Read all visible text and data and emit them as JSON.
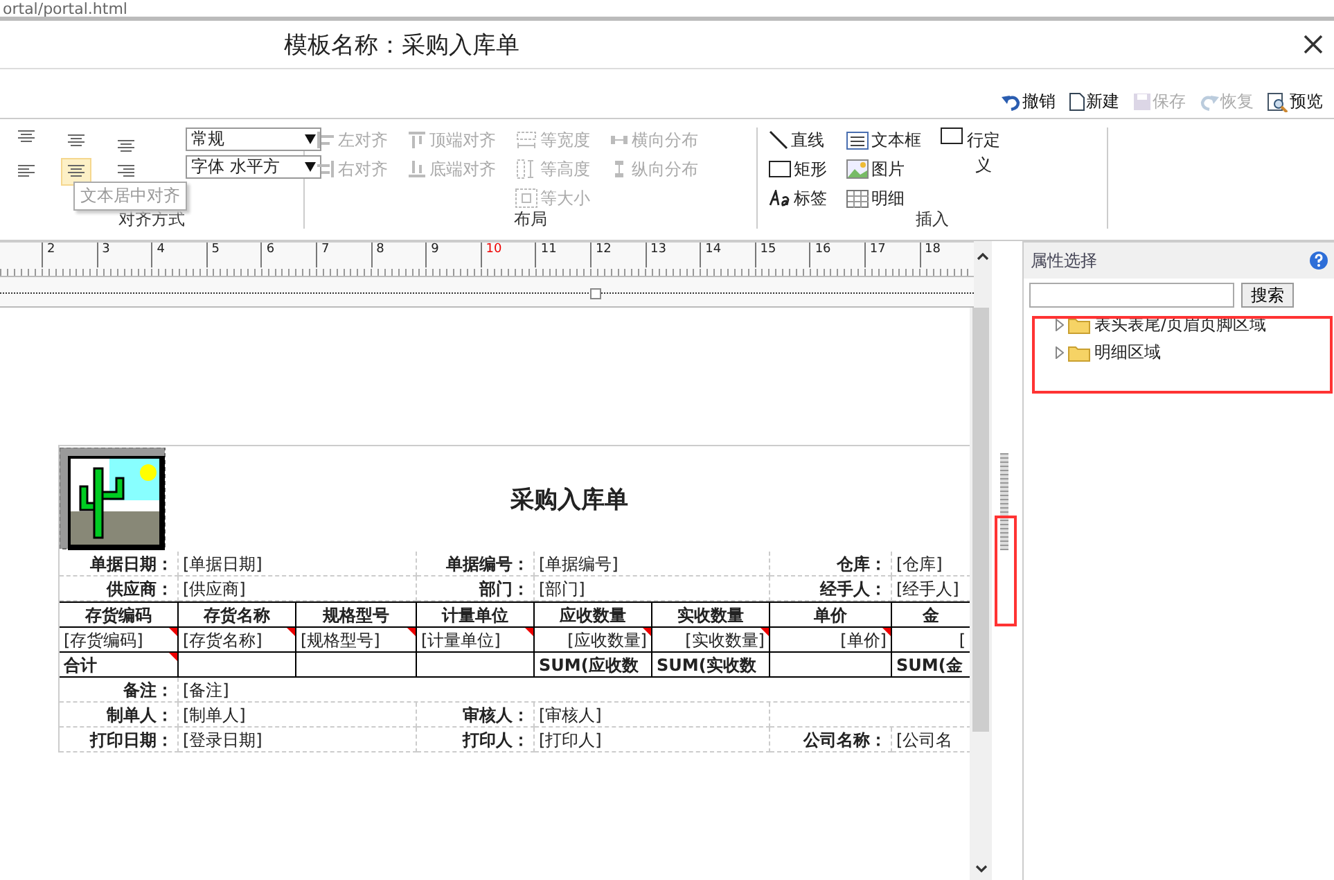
{
  "url": "ortal/portal.html",
  "window": {
    "title": "模板名称：采购入库单"
  },
  "toolbar": [
    {
      "label": "撤销",
      "kind": "undo",
      "disabled": false
    },
    {
      "label": "新建",
      "kind": "new",
      "disabled": false
    },
    {
      "label": "保存",
      "kind": "save",
      "disabled": true
    },
    {
      "label": "恢复",
      "kind": "redo",
      "disabled": true
    },
    {
      "label": "预览",
      "kind": "preview",
      "disabled": false
    }
  ],
  "alignment": {
    "title": "对齐方式",
    "tooltip": "文本居中对齐",
    "buttons": [
      {
        "kind": "top",
        "selected": false
      },
      {
        "kind": "middle",
        "selected": false
      },
      {
        "kind": "bottom",
        "selected": false
      },
      {
        "kind": "left",
        "selected": false
      },
      {
        "kind": "center",
        "selected": true
      },
      {
        "kind": "right",
        "selected": false
      }
    ],
    "selects": [
      "常规",
      "字体 水平方"
    ]
  },
  "layout": {
    "title": "布局",
    "columns": [
      [
        {
          "label": "左对齐",
          "kind": "align-left",
          "disabled": true
        },
        {
          "label": "右对齐",
          "kind": "align-right",
          "disabled": true
        }
      ],
      [
        {
          "label": "顶端对齐",
          "kind": "align-top",
          "disabled": true
        },
        {
          "label": "底端对齐",
          "kind": "align-bottom",
          "disabled": true
        }
      ],
      [
        {
          "label": "等宽度",
          "kind": "same-width",
          "disabled": true
        },
        {
          "label": "等高度",
          "kind": "same-height",
          "disabled": true
        },
        {
          "label": "等大小",
          "kind": "same-size",
          "disabled": true
        }
      ],
      [
        {
          "label": "横向分布",
          "kind": "dist-h",
          "disabled": true
        },
        {
          "label": "纵向分布",
          "kind": "dist-v",
          "disabled": true
        }
      ]
    ]
  },
  "insert": {
    "title": "插入",
    "columns": [
      [
        {
          "label": "直线",
          "kind": "line"
        },
        {
          "label": "矩形",
          "kind": "rect"
        },
        {
          "label": "标签",
          "kind": "label"
        }
      ],
      [
        {
          "label": "文本框",
          "kind": "textbox"
        },
        {
          "label": "图片",
          "kind": "picture"
        },
        {
          "label": "明细",
          "kind": "detail"
        }
      ],
      [
        {
          "label": "行定义",
          "kind": "row"
        }
      ]
    ]
  },
  "ruler": [
    {
      "label": "2",
      "highlighted": false
    },
    {
      "label": "3",
      "highlighted": false
    },
    {
      "label": "4",
      "highlighted": false
    },
    {
      "label": "5",
      "highlighted": false
    },
    {
      "label": "6",
      "highlighted": false
    },
    {
      "label": "7",
      "highlighted": false
    },
    {
      "label": "8",
      "highlighted": false
    },
    {
      "label": "9",
      "highlighted": false
    },
    {
      "label": "10",
      "highlighted": true
    },
    {
      "label": "11",
      "highlighted": false
    },
    {
      "label": "12",
      "highlighted": false
    },
    {
      "label": "13",
      "highlighted": false
    },
    {
      "label": "14",
      "highlighted": false
    },
    {
      "label": "15",
      "highlighted": false
    },
    {
      "label": "16",
      "highlighted": false
    },
    {
      "label": "17",
      "highlighted": false
    },
    {
      "label": "18",
      "highlighted": false
    }
  ],
  "report": {
    "title": "采购入库单",
    "header_rows": [
      [
        {
          "label": "单据日期：",
          "value": "[单据日期]"
        },
        {
          "label": "单据编号：",
          "value": "[单据编号]"
        },
        {
          "label": "仓库：",
          "value": "[仓库]"
        }
      ],
      [
        {
          "label": "供应商：",
          "value": "[供应商]"
        },
        {
          "label": "部门：",
          "value": "[部门]"
        },
        {
          "label": "经手人：",
          "value": "[经手人]"
        }
      ]
    ],
    "detail_columns": [
      "存货编码",
      "存货名称",
      "规格型号",
      "计量单位",
      "应收数量",
      "实收数量",
      "单价",
      "金"
    ],
    "detail_rows": [
      {
        "kind": "data",
        "cells": [
          {
            "text": "[存货编码]",
            "flag": true
          },
          {
            "text": "[存货名称]",
            "flag": true
          },
          {
            "text": "[规格型号]",
            "flag": true
          },
          {
            "text": "[计量单位]",
            "flag": true
          },
          {
            "text": "[应收数量]",
            "flag": true
          },
          {
            "text": "[实收数量]",
            "flag": true
          },
          {
            "text": "[单价]",
            "flag": true
          },
          {
            "text": "[",
            "flag": false
          }
        ]
      },
      {
        "kind": "total",
        "cells": [
          {
            "text": "合计",
            "flag": true
          },
          {
            "flag": false
          },
          {
            "flag": false
          },
          {
            "flag": false
          },
          {
            "text": "SUM(应收数",
            "flag": false
          },
          {
            "text": "SUM(实收数",
            "flag": false
          },
          {
            "flag": false
          },
          {
            "text": "SUM(金",
            "flag": false
          }
        ]
      }
    ],
    "footer_rows": [
      [
        {
          "label": "备注：",
          "value": "[备注]"
        }
      ],
      [
        {
          "label": "制单人：",
          "value": "[制单人]"
        },
        {
          "label": "审核人：",
          "value": "[审核人]"
        }
      ],
      [
        {
          "label": "打印日期：",
          "value": "[登录日期]"
        },
        {
          "label": "打印人：",
          "value": "[打印人]"
        },
        {
          "label": "公司名称：",
          "value": "[公司名"
        }
      ]
    ]
  },
  "panel": {
    "title": "属性选择",
    "search_button": "搜索",
    "tree": [
      {
        "label": "表头表尾/页眉页脚区域",
        "expanded": false
      },
      {
        "label": "明细区域",
        "expanded": false
      }
    ]
  }
}
